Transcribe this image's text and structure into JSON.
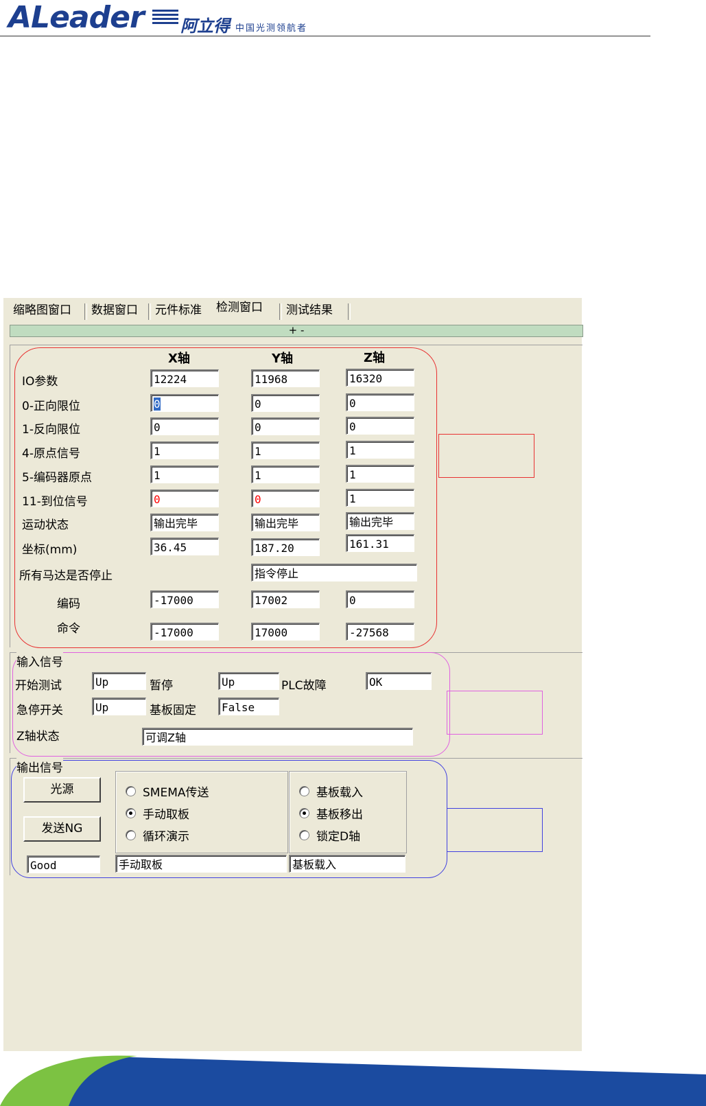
{
  "header": {
    "logo": "ALeader",
    "brand_cn": "阿立得",
    "tagline": "中国光测领航者"
  },
  "tabs": [
    "缩略图窗口",
    "数据窗口",
    "元件标准",
    "检测窗口",
    "测试结果"
  ],
  "collapse_bar": "+ -",
  "axes": {
    "headers": [
      "X轴",
      "Y轴",
      "Z轴"
    ],
    "rows": [
      {
        "label": "IO参数",
        "values": [
          "12224",
          "11968",
          "16320"
        ]
      },
      {
        "label": "0-正向限位",
        "values": [
          "0",
          "0",
          "0"
        ]
      },
      {
        "label": "1-反向限位",
        "values": [
          "0",
          "0",
          "0"
        ]
      },
      {
        "label": "4-原点信号",
        "values": [
          "1",
          "1",
          "1"
        ]
      },
      {
        "label": "5-编码器原点",
        "values": [
          "1",
          "1",
          "1"
        ]
      },
      {
        "label": "11-到位信号",
        "values": [
          "0",
          "0",
          "1"
        ]
      },
      {
        "label": "运动状态",
        "values": [
          "输出完毕",
          "输出完毕",
          "输出完毕"
        ]
      },
      {
        "label": "坐标(mm)",
        "values": [
          "36.45",
          "187.20",
          "161.31"
        ]
      }
    ],
    "all_motors_label": "所有马达是否停止",
    "all_motors_value": "指令停止",
    "encoder_label": "编码",
    "encoder_values": [
      "-17000",
      "17002",
      "0"
    ],
    "command_label": "命令",
    "command_values": [
      "-17000",
      "17000",
      "-27568"
    ]
  },
  "input_signals": {
    "title": "输入信号",
    "start_test_label": "开始测试",
    "start_test_value": "Up",
    "pause_label": "暂停",
    "pause_value": "Up",
    "plc_label": "PLC故障",
    "plc_value": "OK",
    "estop_label": "急停开关",
    "estop_value": "Up",
    "board_fix_label": "基板固定",
    "board_fix_value": "False",
    "z_state_label": "Z轴状态",
    "z_state_value": "可调Z轴"
  },
  "output_signals": {
    "title": "输出信号",
    "light_button": "光源",
    "send_ng_button": "发送NG",
    "mode_options": [
      "SMEMA传送",
      "手动取板",
      "循环演示"
    ],
    "mode_selected": 1,
    "board_options": [
      "基板载入",
      "基板移出",
      "锁定D轴"
    ],
    "board_selected": 1,
    "status_value": "Good",
    "mode_value": "手动取板",
    "board_value": "基板载入"
  },
  "colors": {
    "brand_blue": "#1d3f8f",
    "panel_bg": "#ece9d8",
    "axes_outline": "#e83030",
    "input_outline": "#e060e0",
    "output_outline": "#4040e0",
    "footer_green": "#7cc242",
    "footer_blue": "#1b4ba0"
  }
}
